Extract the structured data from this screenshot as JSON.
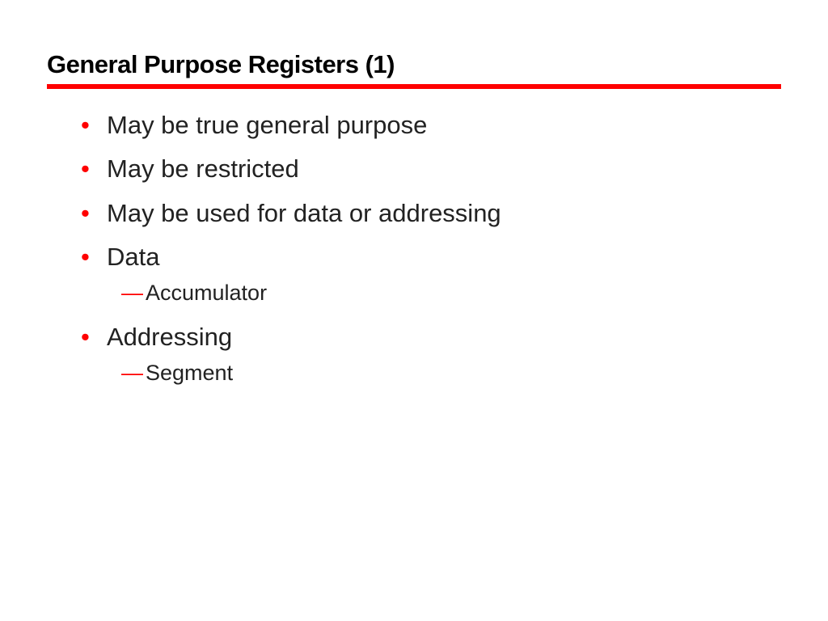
{
  "title": "General Purpose Registers (1)",
  "bullets": {
    "b0": "May be true general purpose",
    "b1": "May be restricted",
    "b2": "May be used for data or addressing",
    "b3": "Data",
    "b3_sub0": "Accumulator",
    "b4": "Addressing",
    "b4_sub0": "Segment"
  }
}
